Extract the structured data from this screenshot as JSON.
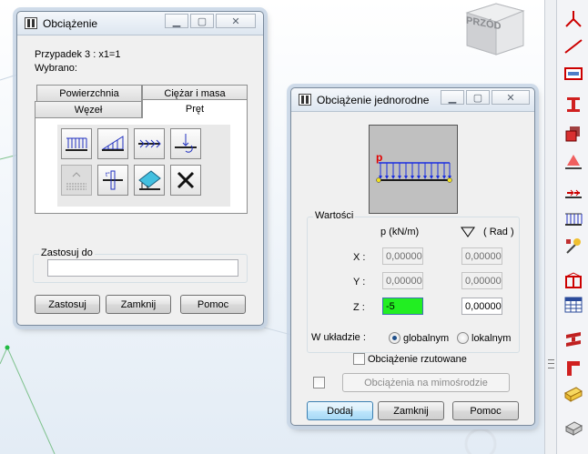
{
  "viewport": {
    "cube_label": "PRZÓD"
  },
  "win1": {
    "title": "Obciążenie",
    "case_line": "Przypadek 3 : x1=1",
    "selected_line": "Wybrano:",
    "tabs_row1": [
      "Powierzchnia",
      "Ciężar i masa"
    ],
    "tabs_row2": [
      "Węzeł",
      "Pręt"
    ],
    "active_tab": "Pręt",
    "tiles": [
      "uniform-load-icon",
      "trapezoidal-load-icon",
      "axial-distributed-load-icon",
      "point-load-icon",
      "thermal-load-icon",
      "temperature-gradient-icon",
      "plane-load-icon",
      "delete-load-icon"
    ],
    "apply_to_label": "Zastosuj do",
    "apply_to_value": "",
    "buttons": {
      "apply": "Zastosuj",
      "close": "Zamknij",
      "help": "Pomoc"
    }
  },
  "win2": {
    "title": "Obciążenie jednorodne",
    "preview_label": "p",
    "values_group": "Wartości",
    "col_p": "p  (kN/m)",
    "col_rad": "( Rad )",
    "rows": [
      {
        "label": "X :",
        "p": "0,00000",
        "rad": "0,00000",
        "disabled": true
      },
      {
        "label": "Y :",
        "p": "0,00000",
        "rad": "0,00000",
        "disabled": true
      },
      {
        "label": "Z :",
        "p": "-5",
        "rad": "0,00000",
        "disabled": false
      }
    ],
    "system_label": "W układzie :",
    "radio_global": "globalnym",
    "radio_local": "lokalnym",
    "projected_label": "Obciążenie rzutowane",
    "eccentric_button": "Obciążenia na mimośrodzie",
    "buttons": {
      "add": "Dodaj",
      "close": "Zamknij",
      "help": "Pomoc"
    }
  },
  "colors": {
    "accent_field": "#22ee22",
    "load_blue": "#1a2ee0",
    "label_red": "#e00000"
  }
}
